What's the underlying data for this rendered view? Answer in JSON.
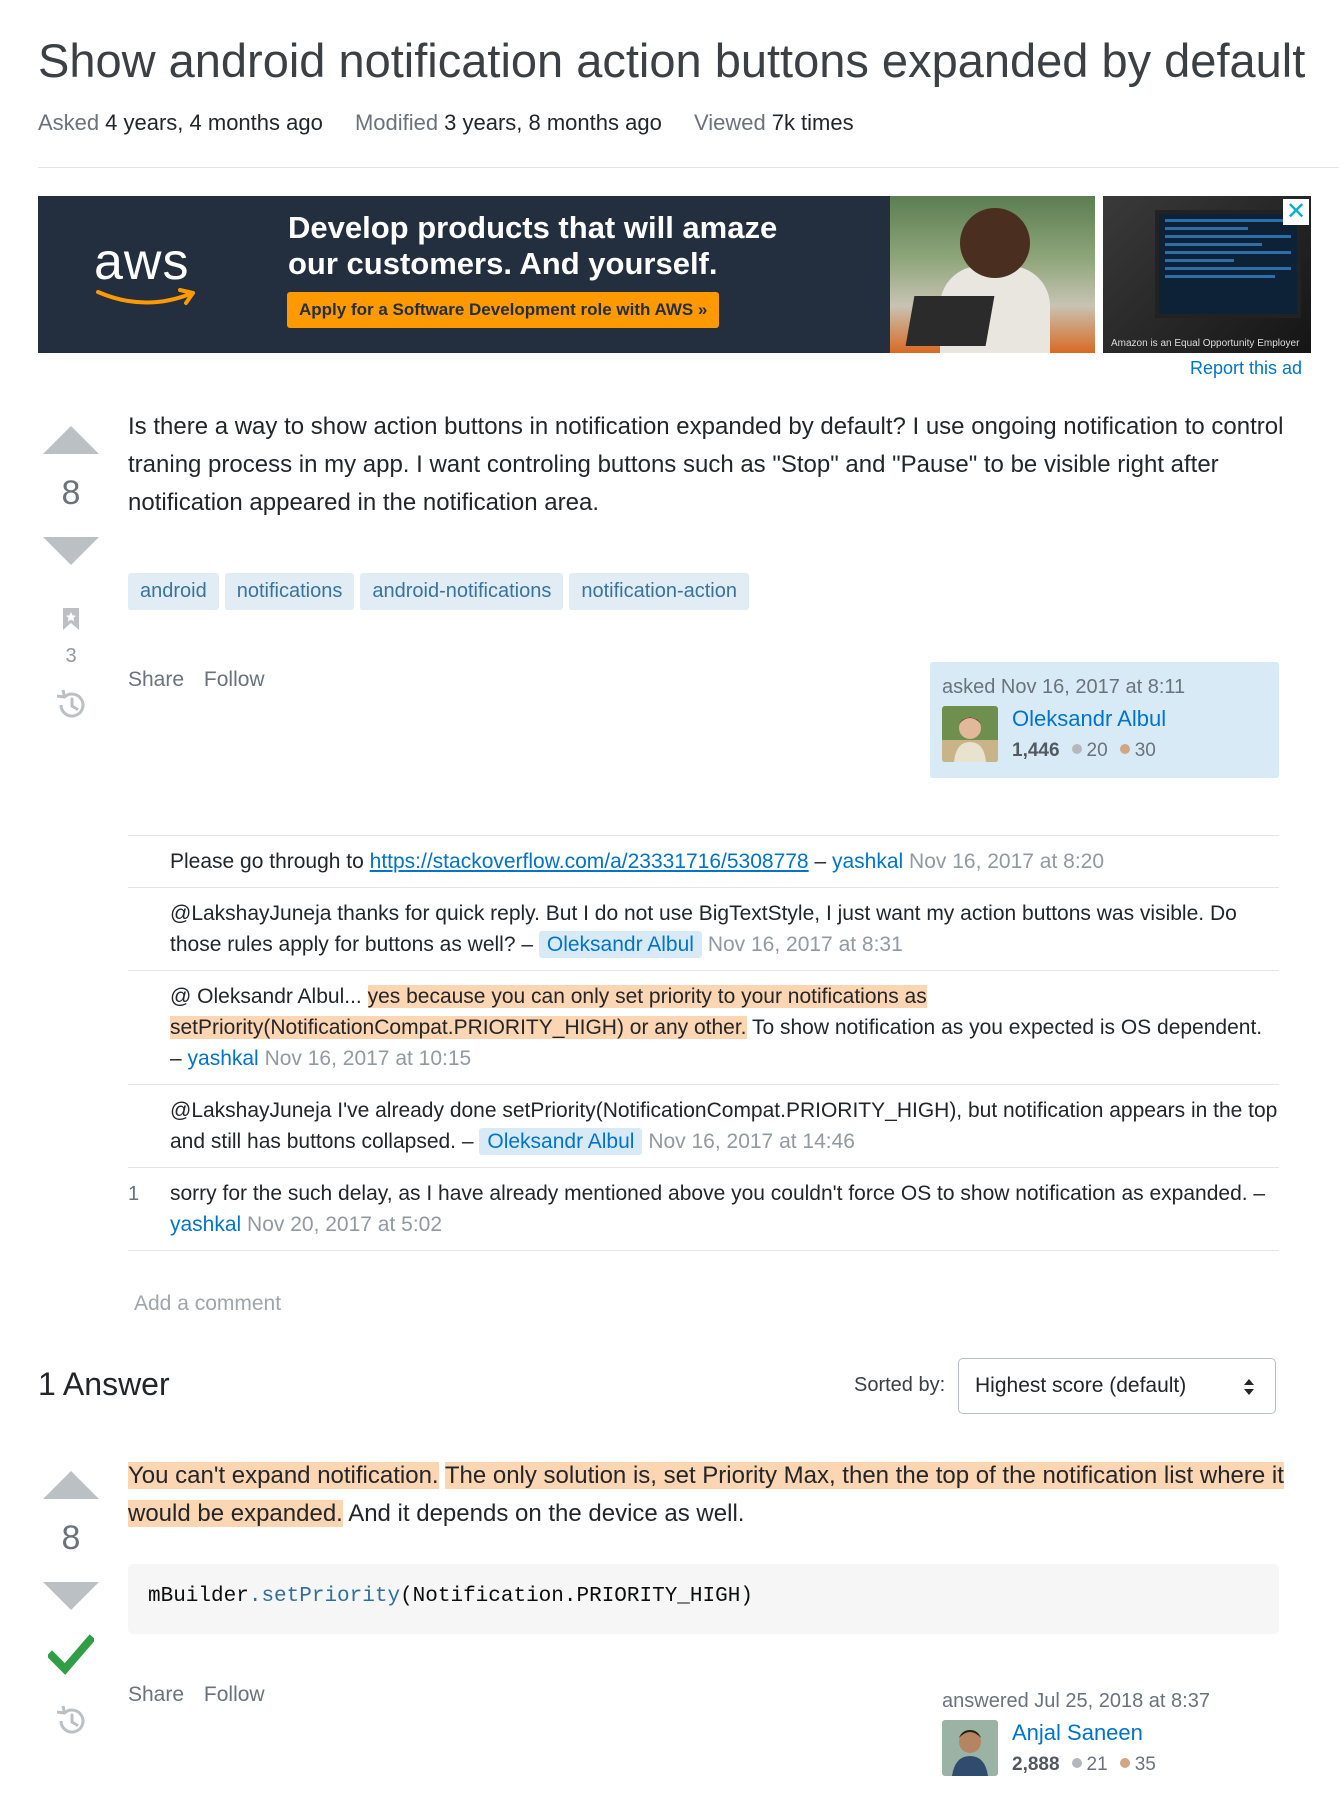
{
  "question": {
    "title": "Show android notification action buttons expanded by default",
    "meta": [
      {
        "label": "Asked",
        "value": "4 years, 4 months ago"
      },
      {
        "label": "Modified",
        "value": "3 years, 8 months ago"
      },
      {
        "label": "Viewed",
        "value": "7k times"
      }
    ],
    "score": "8",
    "bookmark_count": "3",
    "body": "Is there a way to show action buttons in notification expanded by default? I use ongoing notification to control traning process in my app. I want controling buttons such as \"Stop\" and \"Pause\" to be visible right after notification appeared in the notification area.",
    "tags": [
      "android",
      "notifications",
      "android-notifications",
      "notification-action"
    ],
    "menu": {
      "share": "Share",
      "follow": "Follow"
    },
    "owner": {
      "action": "asked Nov 16, 2017 at 8:11",
      "name": "Oleksandr Albul",
      "reputation": "1,446",
      "silver": "20",
      "bronze": "30"
    }
  },
  "ad": {
    "logo": "aws",
    "headline": "Develop products that will amaze our customers. And yourself.",
    "cta": "Apply for a Software Development role with AWS »",
    "eo_text": "Amazon is an Equal Opportunity Employer",
    "close": "✕",
    "report": "Report this ad"
  },
  "comments": [
    {
      "score": "",
      "pre": "Please go through to ",
      "link": "https://stackoverflow.com/a/23331716/5308778",
      "mid": " – ",
      "user": "yashkal",
      "date": "Nov 16, 2017 at 8:20"
    },
    {
      "score": "",
      "text": "@LakshayJuneja thanks for quick reply. But I do not use BigTextStyle, I just want my action buttons was visible. Do those rules apply for buttons as well? – ",
      "user": "Oleksandr Albul",
      "date": "Nov 16, 2017 at 8:31"
    },
    {
      "score": "",
      "pre": "@ Oleksandr Albul... ",
      "highlight": "yes because you can only set priority to your notifications as setPriority(NotificationCompat.PRIORITY_HIGH) or any other.",
      "post": " To show notification as you expected is OS dependent. – ",
      "user": "yashkal",
      "date": "Nov 16, 2017 at 10:15"
    },
    {
      "score": "",
      "text": "@LakshayJuneja I've already done setPriority(NotificationCompat.PRIORITY_HIGH), but notification appears in the top and still has buttons collapsed. – ",
      "user": "Oleksandr Albul",
      "date": "Nov 16, 2017 at 14:46"
    },
    {
      "score": "1",
      "text": "sorry for the such delay, as I have already mentioned above you couldn't force OS to show notification as expanded. – ",
      "user": "yashkal",
      "date": "Nov 20, 2017 at 5:02"
    }
  ],
  "add_comment": "Add a comment",
  "answers_header": {
    "count_label": "1 Answer",
    "sorted_by": "Sorted by:",
    "sort_value": "Highest score (default)"
  },
  "answer": {
    "score": "8",
    "hl1": "You can't expand notification.",
    "hl2": "The only solution is, set Priority Max, then the top of the notification list where it would be expanded.",
    "rest": " And it depends on the device as well.",
    "code": {
      "obj": "mBuilder",
      "dot": ".",
      "fn": "setPriority",
      "args": "(Notification.PRIORITY_HIGH)"
    },
    "menu": {
      "share": "Share",
      "follow": "Follow"
    },
    "owner": {
      "action": "answered Jul 25, 2018 at 8:37",
      "name": "Anjal Saneen",
      "reputation": "2,888",
      "silver": "21",
      "bronze": "35"
    }
  },
  "colors": {
    "accent": "#0074cc",
    "tag_bg": "#e1ecf4",
    "highlight": "#fcd5b2",
    "accepted": "#2f9e44",
    "aws_orange": "#ff9900",
    "aws_navy": "#232f3e"
  }
}
